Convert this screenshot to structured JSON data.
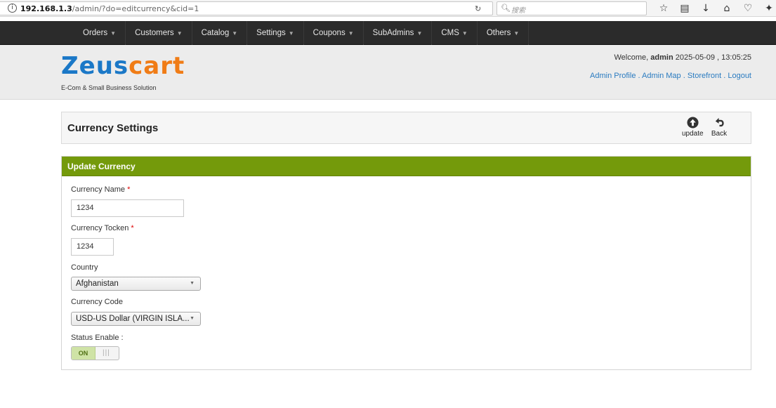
{
  "browser": {
    "url_host": "192.168.1.3",
    "url_path": "/admin/?do=editcurrency&cid=1",
    "search_placeholder": "搜索"
  },
  "nav": {
    "items": [
      "Orders",
      "Customers",
      "Catalog",
      "Settings",
      "Coupons",
      "SubAdmins",
      "CMS",
      "Others"
    ]
  },
  "header": {
    "logo_word_a": "Zeus",
    "logo_word_b": "cart",
    "logo_tagline": "E-Com & Small Business Solution",
    "welcome_prefix": "Welcome,",
    "welcome_user": "admin",
    "datetime": "2025-05-09 , 13:05:25",
    "links": [
      "Admin Profile",
      "Admin Map",
      "Storefront",
      "Logout"
    ]
  },
  "page": {
    "title": "Currency Settings",
    "update_label": "update",
    "back_label": "Back"
  },
  "form": {
    "heading": "Update Currency",
    "currency_name_label": "Currency Name",
    "currency_name_value": "1234",
    "currency_token_label": "Currency Tocken",
    "currency_token_value": "1234",
    "country_label": "Country",
    "country_value": "Afghanistan",
    "currency_code_label": "Currency Code",
    "currency_code_value": "USD-US Dollar (VIRGIN ISLA...",
    "status_label": "Status Enable :",
    "status_value": "ON",
    "required_mark": "*"
  },
  "colors": {
    "form_header": "#749a0b",
    "nav_bg": "#2b2b2b",
    "link": "#2a7bc0",
    "logo_blue": "#1b78c7",
    "logo_orange": "#f07c16"
  }
}
